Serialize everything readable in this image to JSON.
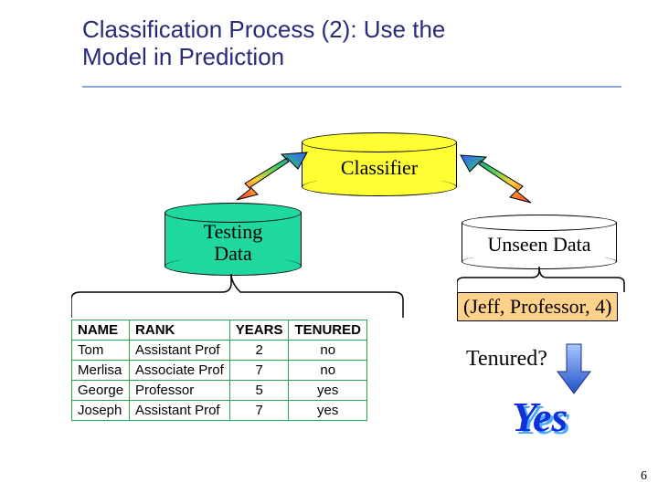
{
  "title_line1": "Classification Process (2): Use the",
  "title_line2": "Model in Prediction",
  "classifier_label": "Classifier",
  "testing_label_l1": "Testing",
  "testing_label_l2": "Data",
  "unseen_label": "Unseen Data",
  "tuple_text": "(Jeff, Professor, 4)",
  "question_text": "Tenured?",
  "answer_text": "Yes",
  "page_number": "6",
  "table": {
    "headers": [
      "NAME",
      "RANK",
      "YEARS",
      "TENURED"
    ],
    "rows": [
      [
        "Tom",
        "Assistant Prof",
        "2",
        "no"
      ],
      [
        "Merlisa",
        "Associate Prof",
        "7",
        "no"
      ],
      [
        "George",
        "Professor",
        "5",
        "yes"
      ],
      [
        "Joseph",
        "Assistant Prof",
        "7",
        "yes"
      ]
    ]
  },
  "colors": {
    "classifier_fill": "#ffff33",
    "testing_fill": "#1fd8a0",
    "unseen_fill": "#fff"
  }
}
